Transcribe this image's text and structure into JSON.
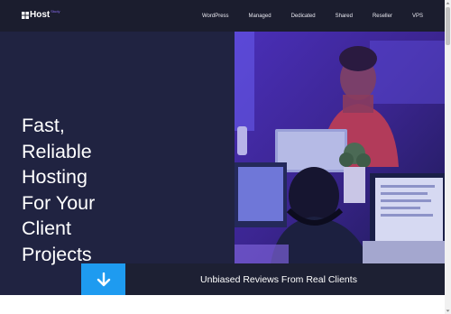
{
  "header": {
    "logo_text": "Host",
    "logo_sup": "Study",
    "nav": [
      {
        "label": "WordPress"
      },
      {
        "label": "Managed"
      },
      {
        "label": "Dedicated"
      },
      {
        "label": "Shared"
      },
      {
        "label": "Reseller"
      },
      {
        "label": "VPS"
      }
    ]
  },
  "hero": {
    "title_lines": [
      "Fast,",
      "Reliable",
      "Hosting",
      "For Your",
      "Client",
      "Projects"
    ]
  },
  "cta": {
    "text": "Unbiased Reviews From Real Clients"
  },
  "colors": {
    "nav_bg": "#1b1d2e",
    "hero_bg": "#202341",
    "accent": "#1e9bf0",
    "image_tint": "#5a3fd6"
  }
}
